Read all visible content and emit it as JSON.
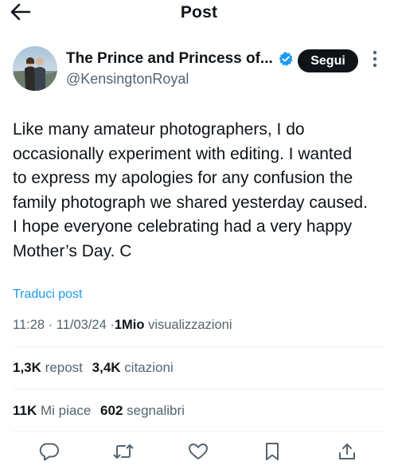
{
  "header": {
    "title": "Post",
    "back_icon": "arrow-left-icon"
  },
  "author": {
    "name": "The Prince and Princess of...",
    "handle": "@KensingtonRoyal",
    "verified_icon": "verified-badge-icon",
    "verified_color": "#1d9bf0"
  },
  "follow_button": {
    "label": "Segui"
  },
  "post": {
    "text": "Like many amateur photographers, I do\noccasionally experiment with editing. I wanted\nto express my apologies for any confusion the\nfamily photograph we shared yesterday caused.\nI hope everyone celebrating had a very happy\nMother’s Day. C"
  },
  "translate_label": "Traduci post",
  "meta": {
    "time": "11:28",
    "separator": "·",
    "date": "11/03/24",
    "views_count": "1Mio",
    "views_label": "visualizzazioni"
  },
  "stats": {
    "reposts_count": "1,3K",
    "reposts_label": "repost",
    "quotes_count": "3,4K",
    "quotes_label": "citazioni",
    "likes_count": "11K",
    "likes_label": "Mi piace",
    "bookmarks_count": "602",
    "bookmarks_label": "segnalibri"
  },
  "actions": [
    "reply-icon",
    "repost-icon",
    "like-icon",
    "bookmark-icon",
    "share-icon"
  ],
  "colors": {
    "text": "#0f1419",
    "secondary_text": "#536471",
    "link": "#1d9bf0",
    "divider": "#eff3f4"
  }
}
